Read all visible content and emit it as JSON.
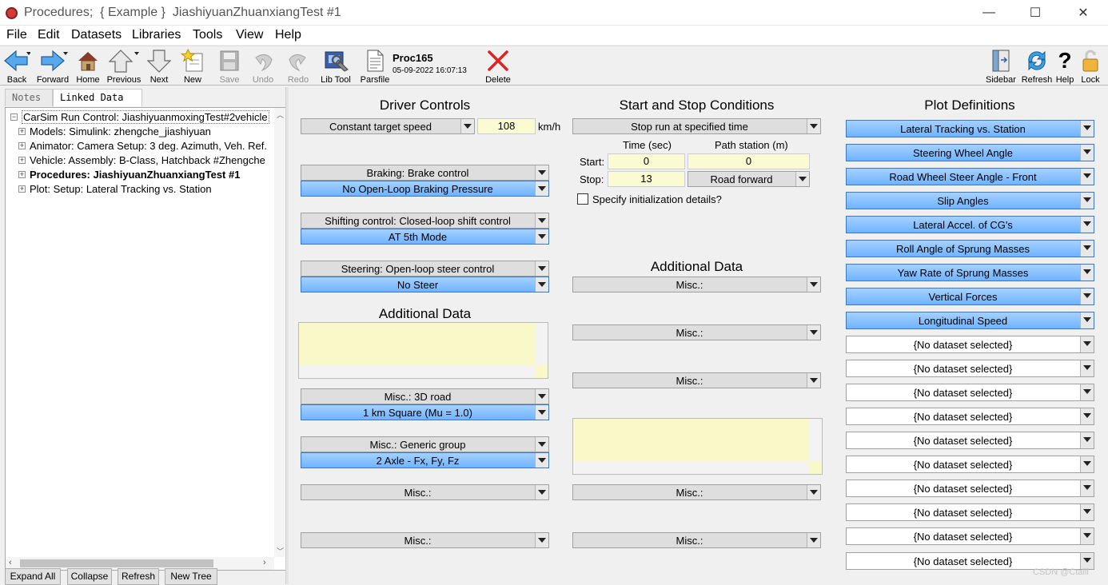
{
  "window": {
    "title": "Procedures;  { Example }  JiashiyuanZhuanxiangTest #1",
    "controls": {
      "minimize": "—",
      "maximize": "☐",
      "close": "✕"
    }
  },
  "menu": [
    "File",
    "Edit",
    "Datasets",
    "Libraries",
    "Tools",
    "View",
    "Help"
  ],
  "toolbar": {
    "back": "Back",
    "forward": "Forward",
    "home": "Home",
    "previous": "Previous",
    "next": "Next",
    "new": "New",
    "save": "Save",
    "undo": "Undo",
    "redo": "Redo",
    "libtool": "Lib Tool",
    "parsfile": "Parsfile",
    "proc_name": "Proc165",
    "proc_date": "05-09-2022 16:07:13",
    "delete": "Delete",
    "sidebar": "Sidebar",
    "refresh": "Refresh",
    "help": "Help",
    "lock": "Lock"
  },
  "left": {
    "tabs": [
      "Notes",
      "Linked Data"
    ],
    "tree": [
      {
        "label": "CarSim Run Control: JiashiyuanmoxingTest#2vehicle",
        "expander": "−",
        "bold": false
      },
      {
        "label": "Models: Simulink: zhengche_jiashiyuan",
        "expander": "+",
        "bold": false
      },
      {
        "label": "Animator: Camera Setup: 3 deg. Azimuth, Veh. Ref.",
        "expander": "+",
        "bold": false
      },
      {
        "label": "Vehicle: Assembly: B-Class, Hatchback #Zhengche",
        "expander": "+",
        "bold": false
      },
      {
        "label": "Procedures: JiashiyuanZhuanxiangTest #1",
        "expander": "+",
        "bold": true
      },
      {
        "label": "Plot: Setup: Lateral Tracking vs. Station",
        "expander": "+",
        "bold": false
      }
    ],
    "buttons": [
      "Expand All",
      "Collapse",
      "Refresh",
      "New Tree"
    ]
  },
  "driver": {
    "title": "Driver Controls",
    "speed_mode": "Constant target speed",
    "speed_value": "108",
    "speed_unit": "km/h",
    "braking_header": "Braking: Brake control",
    "braking_value": "No Open-Loop Braking Pressure",
    "shifting_header": "Shifting control: Closed-loop shift control",
    "shifting_value": "AT 5th Mode",
    "steering_header": "Steering: Open-loop steer control",
    "steering_value": "No Steer",
    "additional_title": "Additional Data",
    "road_header": "Misc.: 3D road",
    "road_value": "1 km Square (Mu = 1.0)",
    "generic_header": "Misc.: Generic group",
    "generic_value": "2 Axle - Fx, Fy, Fz",
    "misc1": "Misc.:",
    "misc2": "Misc.:"
  },
  "startstop": {
    "title": "Start and Stop Conditions",
    "stop_mode": "Stop run at specified time",
    "time_header": "Time (sec)",
    "station_header": "Path station (m)",
    "start_label": "Start:",
    "stop_label": "Stop:",
    "start_time": "0",
    "start_station": "0",
    "stop_time": "13",
    "road_direction": "Road forward",
    "init_label": "Specify initialization details?",
    "additional_title": "Additional Data",
    "misc": [
      "Misc.:",
      "Misc.:",
      "Misc.:",
      "Misc.:",
      "Misc.:"
    ]
  },
  "plots": {
    "title": "Plot Definitions",
    "items": [
      "Lateral Tracking vs. Station",
      "Steering Wheel Angle",
      "Road Wheel Steer Angle - Front",
      "Slip Angles",
      "Lateral Accel. of CG's",
      "Roll Angle of Sprung Masses",
      "Yaw Rate of Sprung Masses",
      "Vertical Forces",
      "Longitudinal Speed",
      "{No dataset selected}",
      "{No dataset selected}",
      "{No dataset selected}",
      "{No dataset selected}",
      "{No dataset selected}",
      "{No dataset selected}",
      "{No dataset selected}",
      "{No dataset selected}",
      "{No dataset selected}",
      "{No dataset selected}"
    ]
  },
  "watermark": "CSDN @Ctalll"
}
